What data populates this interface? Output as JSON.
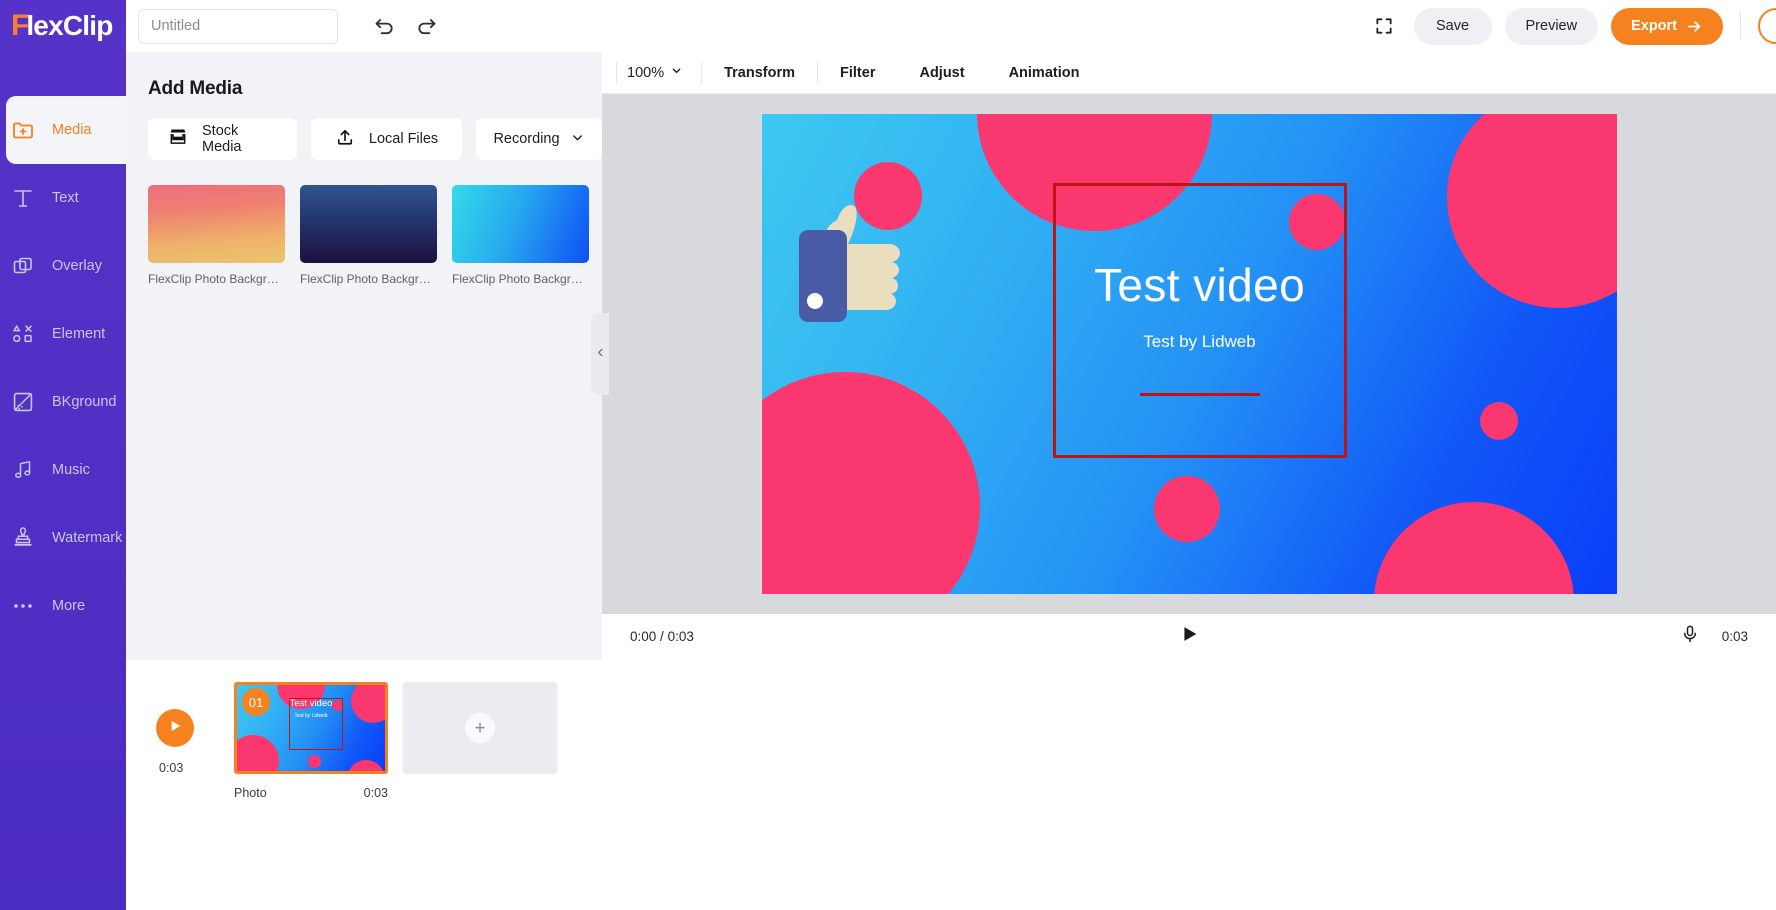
{
  "brand": {
    "logo_f": "F",
    "logo_rest": "lexClip",
    "accent": "#f5821f",
    "rail_bg": "#4f30c4"
  },
  "header": {
    "project_title_value": "",
    "project_title_placeholder": "Untitled",
    "undo_icon": "undo-icon",
    "redo_icon": "redo-icon",
    "fullscreen_icon": "fullscreen-icon",
    "save_label": "Save",
    "preview_label": "Preview",
    "export_label": "Export",
    "export_arrow": "arrow-right-icon",
    "avatar_icon": "avatar"
  },
  "sidebar": {
    "items": [
      {
        "label": "Media",
        "icon": "folder-plus-icon",
        "active": true
      },
      {
        "label": "Text",
        "icon": "text-t-icon",
        "active": false
      },
      {
        "label": "Overlay",
        "icon": "layers-icon",
        "active": false
      },
      {
        "label": "Element",
        "icon": "shapes-icon",
        "active": false
      },
      {
        "label": "BKground",
        "icon": "background-icon",
        "active": false
      },
      {
        "label": "Music",
        "icon": "music-note-icon",
        "active": false
      },
      {
        "label": "Watermark",
        "icon": "stamp-icon",
        "active": false
      },
      {
        "label": "More",
        "icon": "more-dots-icon",
        "active": false
      }
    ]
  },
  "media_panel": {
    "heading": "Add Media",
    "sources": [
      {
        "label": "Stock Media",
        "icon": "store-icon"
      },
      {
        "label": "Local Files",
        "icon": "upload-icon"
      },
      {
        "label": "Recording",
        "icon": "chevron-down-icon"
      }
    ],
    "items": [
      {
        "caption": "FlexClip Photo Backgrou...",
        "style": "warm-gradient"
      },
      {
        "caption": "FlexClip Photo Backgrou...",
        "style": "navy-gradient"
      },
      {
        "caption": "FlexClip Photo Backgrou...",
        "style": "cyan-blue-gradient"
      }
    ],
    "collapse_icon": "chevron-left-icon"
  },
  "canvas_toolbar": {
    "zoom_value": "100%",
    "zoom_caret": "chevron-down-icon",
    "tabs": [
      {
        "label": "Transform"
      },
      {
        "label": "Filter"
      },
      {
        "label": "Adjust"
      },
      {
        "label": "Animation"
      }
    ]
  },
  "canvas": {
    "title": "Test video",
    "subtitle": "Test by Lidweb",
    "selection_color": "#bf1414",
    "bg_blue": "#1a7ef5",
    "blob_pink": "#fb3770",
    "thumb_skin": "#e9debf",
    "thumb_sleeve": "#4a5ba6"
  },
  "player": {
    "current_time": "0:00",
    "separator": "/",
    "duration": "0:03",
    "play_icon": "play-icon",
    "mic_icon": "microphone-icon",
    "total_time": "0:03"
  },
  "timeline": {
    "play_icon": "play-icon",
    "play_duration": "0:03",
    "clip": {
      "badge": "01",
      "type_label": "Photo",
      "duration": "0:03",
      "title": "Test video",
      "subtitle": "Test by Lidweb"
    },
    "add_icon": "plus-icon"
  }
}
